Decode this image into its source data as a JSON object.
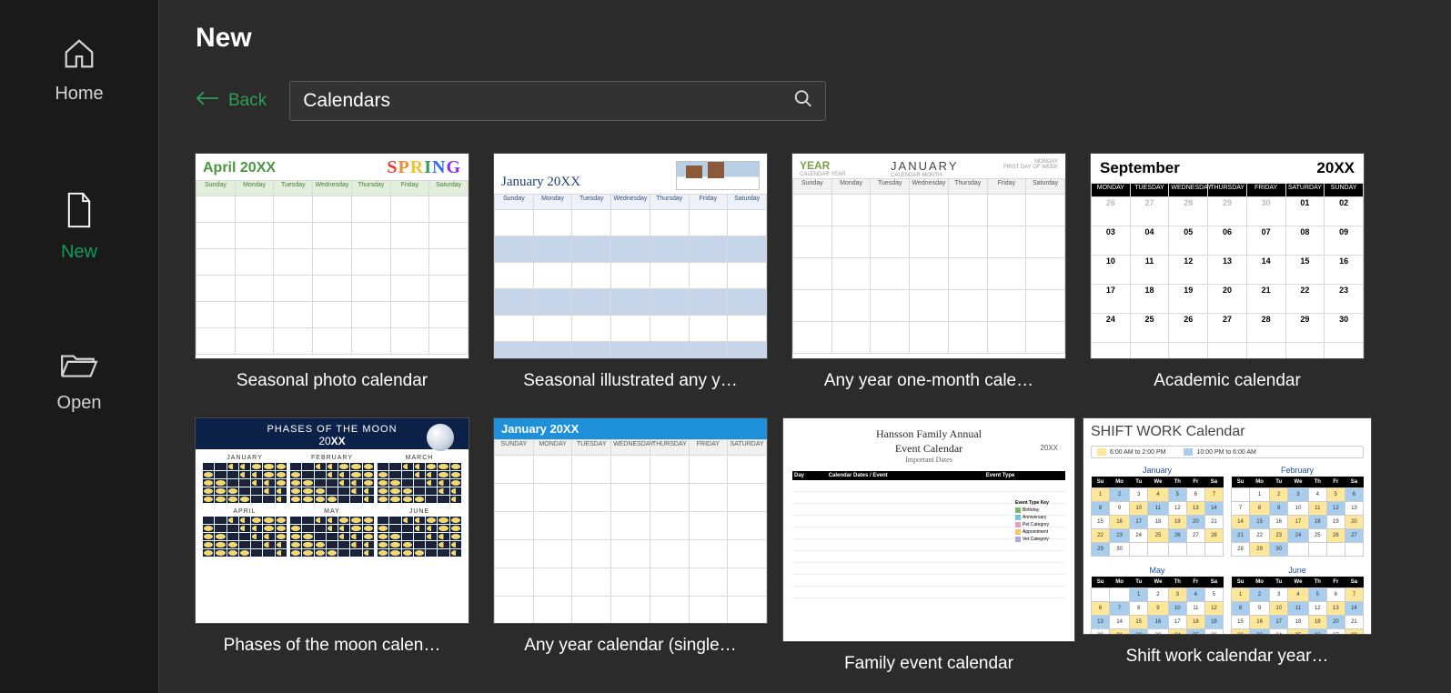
{
  "sidebar": {
    "items": [
      {
        "key": "home",
        "label": "Home"
      },
      {
        "key": "new",
        "label": "New"
      },
      {
        "key": "open",
        "label": "Open"
      }
    ],
    "active": "new"
  },
  "page": {
    "title": "New",
    "back": "Back",
    "search_value": "Calendars"
  },
  "templates": [
    {
      "name": "Seasonal photo calendar",
      "thumb": {
        "title": "April 20XX",
        "banner": "SPRING"
      }
    },
    {
      "name": "Seasonal illustrated any y…",
      "thumb": {
        "title": "January 20XX"
      }
    },
    {
      "name": "Any year one-month cale…",
      "thumb": {
        "year_label": "YEAR",
        "month": "JANUARY",
        "sub1": "CALENDAR YEAR",
        "sub2": "CALENDAR MONTH",
        "weekday": "MONDAY",
        "hint": "FIRST DAY OF WEEK"
      }
    },
    {
      "name": "Academic calendar",
      "thumb": {
        "month": "September",
        "year": "20XX"
      }
    },
    {
      "name": "Phases of the moon calen…",
      "thumb": {
        "title": "PHASES OF THE MOON",
        "year": "20XX",
        "months": [
          "JANUARY",
          "FEBRUARY",
          "MARCH",
          "APRIL",
          "MAY",
          "JUNE"
        ]
      }
    },
    {
      "name": "Any year calendar (single…",
      "thumb": {
        "title": "January 20XX"
      }
    },
    {
      "name": "Family event calendar",
      "thumb": {
        "title1": "Hansson Family Annual",
        "title2": "Event Calendar",
        "sub": "Important Dates",
        "year": "20XX",
        "columns": [
          "Day",
          "Calendar Dates / Event",
          "Event Type"
        ],
        "key_label": "Event Type Key",
        "tags": [
          [
            "#79b96b",
            "Birthday"
          ],
          [
            "#6fc9d4",
            "Anniversary"
          ],
          [
            "#e6a1c4",
            "Pet Category"
          ],
          [
            "#f6c56b",
            "Appointment"
          ],
          [
            "#b0a6dd",
            "Vet Category"
          ]
        ]
      }
    },
    {
      "name": "Shift work calendar year…",
      "thumb": {
        "title": "SHIFT WORK",
        "title2": "Calendar",
        "legend": [
          [
            "#ffe79a",
            "6:00 AM to 2:00 PM"
          ],
          [
            "#a9cdec",
            "10:00 PM to 6:00 AM"
          ]
        ],
        "months": [
          "January",
          "February",
          "May",
          "June"
        ],
        "days": [
          "Su",
          "Mo",
          "Tu",
          "We",
          "Th",
          "Fr",
          "Sa"
        ]
      }
    }
  ],
  "days_full": [
    "Sunday",
    "Monday",
    "Tuesday",
    "Wednesday",
    "Thursday",
    "Friday",
    "Saturday"
  ],
  "days_short": [
    "Sun",
    "Mon",
    "Tue",
    "Wed",
    "Thu",
    "Fri",
    "Sat"
  ],
  "days_min": [
    "Su",
    "Mo",
    "Tu",
    "We",
    "Th",
    "Fr",
    "Sa"
  ]
}
